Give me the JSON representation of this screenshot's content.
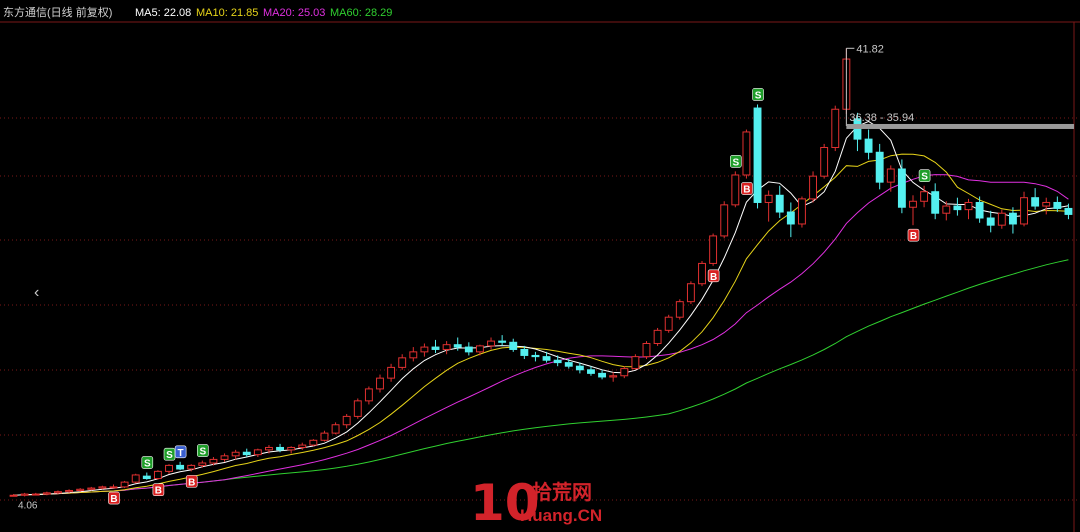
{
  "header": {
    "title": "东方通信(日线 前复权)",
    "ma5": "MA5: 22.08",
    "ma10": "MA10: 21.85",
    "ma20": "MA20: 25.03",
    "ma60": "MA60: 28.29"
  },
  "colors": {
    "up": "#e03030",
    "down": "#54f0f0",
    "ma5": "#ffffff",
    "ma10": "#e6d319",
    "ma20": "#e030e0",
    "ma60": "#30d030",
    "grid": "#7a1818"
  },
  "nav": {
    "left_arrow": "‹"
  },
  "watermark": {
    "brand": "10",
    "cn": "拾荒网",
    "url": "Huang.CN"
  },
  "chart_data": {
    "type": "candlestick",
    "ylim": [
      3,
      44
    ],
    "high_label": "41.82",
    "low_label": "4.06",
    "range_label": "36.38 - 35.94",
    "candles": [
      [
        4.4,
        4.5,
        4.3,
        4.4
      ],
      [
        4.4,
        4.6,
        4.3,
        4.5
      ],
      [
        4.5,
        4.6,
        4.4,
        4.5
      ],
      [
        4.5,
        4.7,
        4.4,
        4.6
      ],
      [
        4.6,
        4.8,
        4.5,
        4.7
      ],
      [
        4.7,
        4.9,
        4.6,
        4.8
      ],
      [
        4.8,
        5.0,
        4.7,
        4.9
      ],
      [
        4.9,
        5.1,
        4.8,
        5.0
      ],
      [
        5.0,
        5.2,
        4.9,
        5.1
      ],
      [
        5.1,
        5.3,
        5.0,
        5.1
      ],
      [
        5.1,
        5.6,
        5.0,
        5.5
      ],
      [
        5.5,
        6.2,
        5.4,
        6.1
      ],
      [
        6.0,
        6.3,
        5.7,
        5.8
      ],
      [
        5.8,
        6.5,
        5.7,
        6.4
      ],
      [
        6.4,
        7.0,
        6.2,
        6.9
      ],
      [
        6.9,
        7.2,
        6.5,
        6.6
      ],
      [
        6.6,
        7.0,
        6.4,
        6.9
      ],
      [
        6.9,
        7.3,
        6.7,
        7.1
      ],
      [
        7.1,
        7.6,
        6.9,
        7.4
      ],
      [
        7.4,
        7.9,
        7.2,
        7.7
      ],
      [
        7.7,
        8.2,
        7.4,
        8.0
      ],
      [
        8.0,
        8.3,
        7.6,
        7.8
      ],
      [
        7.8,
        8.3,
        7.6,
        8.2
      ],
      [
        8.2,
        8.6,
        7.9,
        8.4
      ],
      [
        8.4,
        8.7,
        8.0,
        8.2
      ],
      [
        8.2,
        8.5,
        7.9,
        8.4
      ],
      [
        8.4,
        8.8,
        8.2,
        8.6
      ],
      [
        8.6,
        9.1,
        8.5,
        9.0
      ],
      [
        9.0,
        9.8,
        8.9,
        9.6
      ],
      [
        9.6,
        10.5,
        9.5,
        10.3
      ],
      [
        10.3,
        11.2,
        10.0,
        11.0
      ],
      [
        11.0,
        12.5,
        10.8,
        12.3
      ],
      [
        12.3,
        13.5,
        12.0,
        13.3
      ],
      [
        13.3,
        14.5,
        13.0,
        14.2
      ],
      [
        14.2,
        15.4,
        13.9,
        15.1
      ],
      [
        15.1,
        16.2,
        14.9,
        15.9
      ],
      [
        15.9,
        16.8,
        15.6,
        16.4
      ],
      [
        16.4,
        17.1,
        16.0,
        16.8
      ],
      [
        16.8,
        17.4,
        16.3,
        16.6
      ],
      [
        16.6,
        17.3,
        16.2,
        17.0
      ],
      [
        17.0,
        17.6,
        16.5,
        16.8
      ],
      [
        16.8,
        17.2,
        16.1,
        16.4
      ],
      [
        16.4,
        17.0,
        16.1,
        16.9
      ],
      [
        16.9,
        17.6,
        16.6,
        17.3
      ],
      [
        17.3,
        17.8,
        16.9,
        17.2
      ],
      [
        17.2,
        17.5,
        16.4,
        16.6
      ],
      [
        16.6,
        16.9,
        15.8,
        16.1
      ],
      [
        16.1,
        16.4,
        15.6,
        16.0
      ],
      [
        16.0,
        16.4,
        15.5,
        15.7
      ],
      [
        15.7,
        16.1,
        15.2,
        15.5
      ],
      [
        15.5,
        15.8,
        15.0,
        15.2
      ],
      [
        15.2,
        15.5,
        14.6,
        14.9
      ],
      [
        14.9,
        15.2,
        14.4,
        14.6
      ],
      [
        14.6,
        14.9,
        14.1,
        14.3
      ],
      [
        14.3,
        14.7,
        13.9,
        14.4
      ],
      [
        14.4,
        15.2,
        14.2,
        15.0
      ],
      [
        15.0,
        16.2,
        14.9,
        16.0
      ],
      [
        16.0,
        17.3,
        15.8,
        17.1
      ],
      [
        17.1,
        18.4,
        16.9,
        18.2
      ],
      [
        18.2,
        19.5,
        18.0,
        19.3
      ],
      [
        19.3,
        20.8,
        19.1,
        20.6
      ],
      [
        20.6,
        22.3,
        20.4,
        22.1
      ],
      [
        22.1,
        24.0,
        21.9,
        23.8
      ],
      [
        23.8,
        26.3,
        23.6,
        26.1
      ],
      [
        26.1,
        29.0,
        25.9,
        28.7
      ],
      [
        28.7,
        31.5,
        28.5,
        31.2
      ],
      [
        31.2,
        35.0,
        30.9,
        34.8
      ],
      [
        36.8,
        37.1,
        28.4,
        28.9
      ],
      [
        28.9,
        29.9,
        27.3,
        29.5
      ],
      [
        29.5,
        30.3,
        27.6,
        28.1
      ],
      [
        28.1,
        28.9,
        26.0,
        27.1
      ],
      [
        27.1,
        29.4,
        26.8,
        29.2
      ],
      [
        29.2,
        31.5,
        28.9,
        31.1
      ],
      [
        31.1,
        33.8,
        30.9,
        33.5
      ],
      [
        33.5,
        37.0,
        33.2,
        36.7
      ],
      [
        36.7,
        41.8,
        36.3,
        40.9
      ],
      [
        35.9,
        36.4,
        33.2,
        34.2
      ],
      [
        34.2,
        35.0,
        32.5,
        33.1
      ],
      [
        33.1,
        33.8,
        30.0,
        30.6
      ],
      [
        30.6,
        32.0,
        29.8,
        31.7
      ],
      [
        31.7,
        32.5,
        28.0,
        28.5
      ],
      [
        28.5,
        29.5,
        27.0,
        29.0
      ],
      [
        29.0,
        30.3,
        28.5,
        29.8
      ],
      [
        29.8,
        30.5,
        27.5,
        28.0
      ],
      [
        28.0,
        29.0,
        27.4,
        28.6
      ],
      [
        28.6,
        29.3,
        27.8,
        28.3
      ],
      [
        28.3,
        29.2,
        27.5,
        28.9
      ],
      [
        28.9,
        29.4,
        27.2,
        27.6
      ],
      [
        27.6,
        28.2,
        26.4,
        27.0
      ],
      [
        27.0,
        28.3,
        26.7,
        28.0
      ],
      [
        28.0,
        28.5,
        26.3,
        27.1
      ],
      [
        27.1,
        29.8,
        26.9,
        29.3
      ],
      [
        29.3,
        30.1,
        28.3,
        28.6
      ],
      [
        28.6,
        29.3,
        27.9,
        28.9
      ],
      [
        28.9,
        29.4,
        28.1,
        28.4
      ],
      [
        28.4,
        28.8,
        27.5,
        27.9
      ]
    ],
    "signals": [
      {
        "i": 9,
        "t": "B"
      },
      {
        "i": 12,
        "t": "S"
      },
      {
        "i": 13,
        "t": "B"
      },
      {
        "i": 14,
        "t": "S"
      },
      {
        "i": 15,
        "t": "T"
      },
      {
        "i": 16,
        "t": "B"
      },
      {
        "i": 17,
        "t": "S"
      },
      {
        "i": 63,
        "t": "B"
      },
      {
        "i": 65,
        "t": "S"
      },
      {
        "i": 66,
        "t": "B"
      },
      {
        "i": 67,
        "t": "S"
      },
      {
        "i": 81,
        "t": "B"
      },
      {
        "i": 82,
        "t": "S"
      }
    ]
  }
}
